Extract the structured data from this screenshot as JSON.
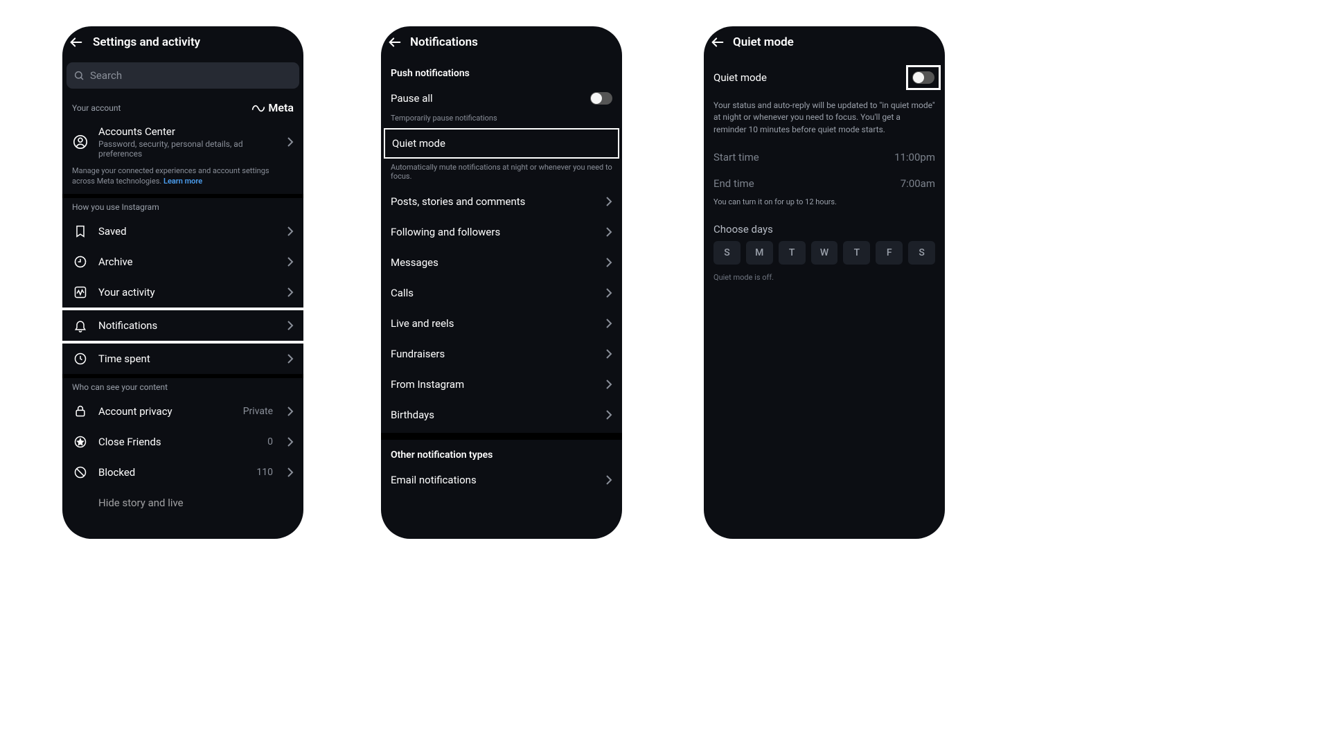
{
  "screen1": {
    "title": "Settings and activity",
    "search_placeholder": "Search",
    "your_account": {
      "heading": "Your account",
      "brand": "Meta",
      "accounts_center": {
        "title": "Accounts Center",
        "subtitle": "Password, security, personal details, ad preferences"
      },
      "desc_prefix": "Manage your connected experiences and account settings across Meta technologies. ",
      "desc_link": "Learn more"
    },
    "how_you_use": {
      "heading": "How you use Instagram",
      "items": [
        "Saved",
        "Archive",
        "Your activity",
        "Notifications",
        "Time spent"
      ]
    },
    "who_can_see": {
      "heading": "Who can see your content",
      "items": [
        {
          "label": "Account privacy",
          "trail": "Private"
        },
        {
          "label": "Close Friends",
          "trail": "0"
        },
        {
          "label": "Blocked",
          "trail": "110"
        },
        {
          "label": "Hide story and live",
          "trail": ""
        }
      ]
    }
  },
  "screen2": {
    "title": "Notifications",
    "push_heading": "Push notifications",
    "pause_all": "Pause all",
    "pause_desc": "Temporarily pause notifications",
    "quiet_mode": "Quiet mode",
    "quiet_desc": "Automatically mute notifications at night or whenever you need to focus.",
    "categories": [
      "Posts, stories and comments",
      "Following and followers",
      "Messages",
      "Calls",
      "Live and reels",
      "Fundraisers",
      "From Instagram",
      "Birthdays"
    ],
    "other_heading": "Other notification types",
    "email_notifications": "Email notifications"
  },
  "screen3": {
    "title": "Quiet mode",
    "toggle_label": "Quiet mode",
    "desc": "Your status and auto-reply will be updated to \"in quiet mode\" at night or whenever you need to focus. You'll get a reminder 10 minutes before quiet mode starts.",
    "start_label": "Start time",
    "start_value": "11:00pm",
    "end_label": "End time",
    "end_value": "7:00am",
    "limit_note": "You can turn it on for up to 12 hours.",
    "choose_days": "Choose days",
    "days": [
      "S",
      "M",
      "T",
      "W",
      "T",
      "F",
      "S"
    ],
    "status": "Quiet mode is off."
  }
}
